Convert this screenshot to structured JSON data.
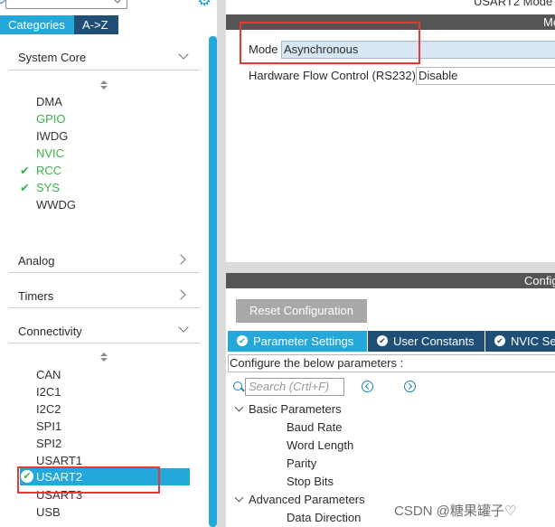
{
  "left_panel": {
    "tabs": [
      "Categories",
      "A->Z"
    ],
    "categories": {
      "system_core": "System Core",
      "analog": "Analog",
      "timers": "Timers",
      "connectivity": "Connectivity"
    },
    "system_core_items": [
      "DMA",
      "GPIO",
      "IWDG",
      "NVIC",
      "RCC",
      "SYS",
      "WWDG"
    ],
    "connectivity_items": [
      "CAN",
      "I2C1",
      "I2C2",
      "SPI1",
      "SPI2",
      "USART1",
      "USART2",
      "USART3",
      "USB"
    ],
    "selected_item": "USART2",
    "check_icon": "✔",
    "usart2_icon": "✔"
  },
  "mode_section": {
    "title": "USART2 Mode",
    "bar_text": "Mo",
    "mode_label": "Mode",
    "mode_value": "Asynchronous",
    "hfc_label": "Hardware Flow Control (RS232)",
    "hfc_value": "Disable"
  },
  "config_section": {
    "bar_text": "Configu",
    "reset_button": "Reset Configuration",
    "tabs": [
      "Parameter Settings",
      "User Constants",
      "NVIC Se"
    ],
    "description": "Configure the below parameters :",
    "search_placeholder": "Search (Crtl+F)",
    "basic_parameters": "Basic Parameters",
    "basic_items": [
      "Baud Rate",
      "Word Length",
      "Parity",
      "Stop Bits"
    ],
    "advanced_parameters": "Advanced Parameters",
    "advanced_items": [
      "Data Direction"
    ]
  },
  "watermark": "CSDN @糖果罐子♡",
  "colors": {
    "accent_blue": "#23a8d9",
    "dark_navy": "#1f4f76",
    "green": "#3cb44b",
    "highlight_red": "#e53935"
  }
}
